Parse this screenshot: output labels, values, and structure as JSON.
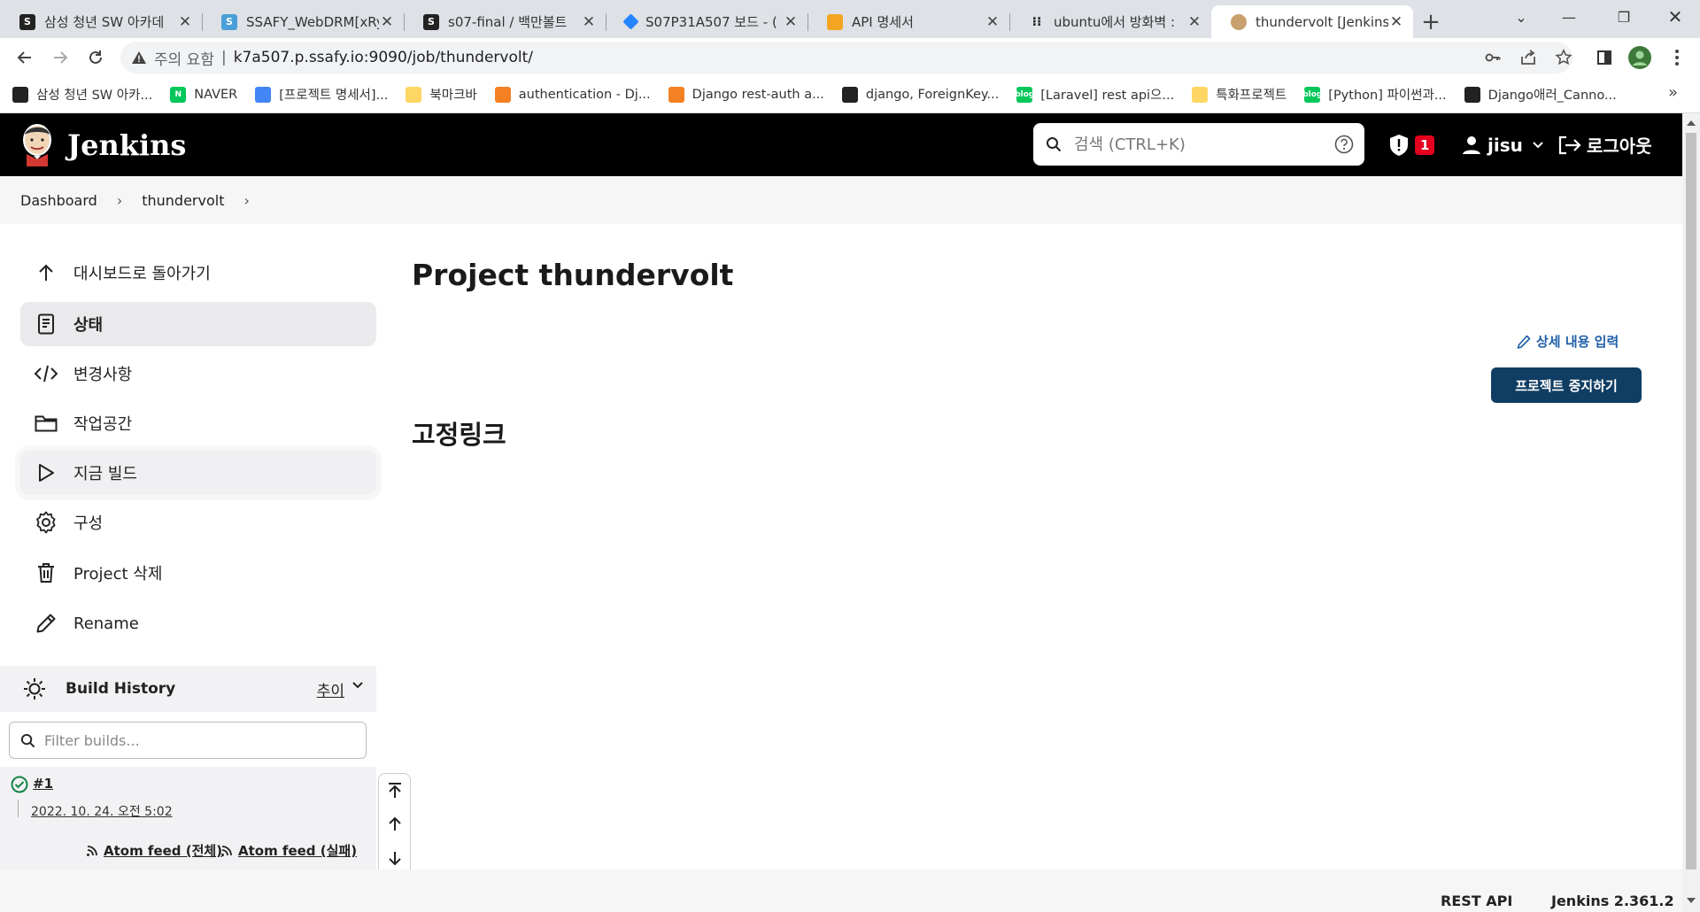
{
  "browser": {
    "tabs": [
      {
        "label": "삼성 청년 SW 아카데",
        "favicon_color": "#222222"
      },
      {
        "label": "SSAFY_WebDRM[xRy]",
        "favicon_color": "#4a9fd8"
      },
      {
        "label": "s07-final / 백만볼트",
        "favicon_color": "#222222"
      },
      {
        "label": "S07P31A507 보드 - (",
        "favicon_color": "#2684ff"
      },
      {
        "label": "API 명세서",
        "favicon_color": "#f4a623"
      },
      {
        "label": "ubuntu에서 방화벽 :",
        "favicon_color": "#222222"
      },
      {
        "label": "thundervolt [Jenkins]",
        "favicon_color": "#c8a06e"
      }
    ],
    "address": {
      "security_label": "주의 요함",
      "url": "k7a507.p.ssafy.io:9090/job/thundervolt/"
    },
    "bookmarks": [
      {
        "label": "삼성 청년 SW 아카...",
        "icon_color": "#222222"
      },
      {
        "label": "NAVER",
        "icon_color": "#03c75a",
        "icon_text": "N"
      },
      {
        "label": "[프로젝트 명세서]...",
        "icon_color": "#4285f4"
      },
      {
        "label": "북마크바",
        "icon_color": "#fdd663"
      },
      {
        "label": "authentication - Dj...",
        "icon_color": "#f48024"
      },
      {
        "label": "Django rest-auth a...",
        "icon_color": "#f48024"
      },
      {
        "label": "django, ForeignKey...",
        "icon_color": "#222222"
      },
      {
        "label": "[Laravel] rest api으...",
        "icon_color": "#03c75a",
        "icon_text": "blog"
      },
      {
        "label": "특화프로젝트",
        "icon_color": "#fdd663"
      },
      {
        "label": "[Python] 파이썬과...",
        "icon_color": "#03c75a",
        "icon_text": "blog"
      },
      {
        "label": "Django애러_Canno...",
        "icon_color": "#222222"
      }
    ],
    "bookmarks_overflow": "»"
  },
  "jenkins": {
    "logo_text": "Jenkins",
    "search_placeholder": "검색 (CTRL+K)",
    "security_badge_count": "1",
    "user": "jisu",
    "logout": "로그아웃"
  },
  "breadcrumb": [
    "Dashboard",
    "thundervolt"
  ],
  "side_tasks": [
    {
      "label": "대시보드로 돌아가기",
      "icon": "arrow-up-icon"
    },
    {
      "label": "상태",
      "icon": "document-icon"
    },
    {
      "label": "변경사항",
      "icon": "code-icon"
    },
    {
      "label": "작업공간",
      "icon": "folder-icon"
    },
    {
      "label": "지금 빌드",
      "icon": "play-icon"
    },
    {
      "label": "구성",
      "icon": "gear-icon"
    },
    {
      "label": "Project 삭제",
      "icon": "trash-icon"
    },
    {
      "label": "Rename",
      "icon": "pencil-icon"
    }
  ],
  "build_history": {
    "title": "Build History",
    "trend_label": "추이",
    "filter_placeholder": "Filter builds...",
    "builds": [
      {
        "number": "#1",
        "date": "2022. 10. 24. 오전 5:02",
        "status": "success"
      }
    ],
    "feeds": [
      "Atom feed (전체)",
      "Atom feed (실패)"
    ]
  },
  "main": {
    "title": "Project thundervolt",
    "edit_description": "상세 내용 입력",
    "disable_button": "프로젝트 중지하기",
    "permalinks_heading": "고정링크"
  },
  "footer": {
    "rest_api": "REST API",
    "version": "Jenkins 2.361.2"
  },
  "colors": {
    "header_bg": "#000000",
    "primary_button": "#103d63",
    "link": "#1f5fa8",
    "success": "#138347",
    "badge": "#e6001f"
  }
}
